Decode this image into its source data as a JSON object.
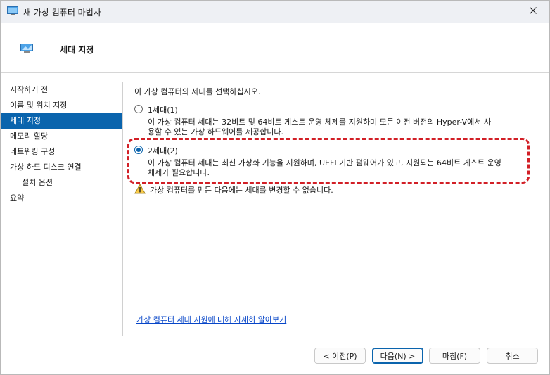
{
  "window": {
    "title": "새 가상 컴퓨터 마법사",
    "icons": {
      "title": "monitor-icon",
      "close": "close-icon"
    }
  },
  "header": {
    "title": "세대 지정",
    "icon": "monitor-icon"
  },
  "sidebar": {
    "items": [
      {
        "label": "시작하기 전"
      },
      {
        "label": "이름 및 위치 지정"
      },
      {
        "label": "세대 지정"
      },
      {
        "label": "메모리 할당"
      },
      {
        "label": "네트워킹 구성"
      },
      {
        "label": "가상 하드 디스크 연결"
      },
      {
        "label": "설치 옵션"
      },
      {
        "label": "요약"
      }
    ],
    "selected": "세대 지정"
  },
  "main": {
    "intro": "이 가상 컴퓨터의 세대를 선택하십시오.",
    "gen1": {
      "label": "1세대(1)",
      "checked": false,
      "desc_line1": "이 가상 컴퓨터 세대는 32비트 및 64비트 게스트 운영 체제를 지원하며 모든 이전 버전의 Hyper-V에서 사",
      "desc_line2": "용할 수 있는 가상 하드웨어를 제공합니다."
    },
    "gen2": {
      "label": "2세대(2)",
      "checked": true,
      "desc_line1": "이 가상 컴퓨터 세대는 최신 가상화 기능을 지원하며, UEFI 기반 펌웨어가 있고, 지원되는 64비트 게스트 운영",
      "desc_line2": "체제가 필요합니다."
    },
    "warning": "가상 컴퓨터를 만든 다음에는 세대를 변경할 수 없습니다.",
    "learn_more": "가상 컴퓨터 세대 지원에 대해 자세히 알아보기"
  },
  "buttons": {
    "previous": "< 이전(P)",
    "next": "다음(N) >",
    "finish": "마침(F)",
    "cancel": "취소"
  },
  "colors": {
    "accent": "#0a64ad",
    "highlight": "#d21f26",
    "link": "#0645c8"
  }
}
